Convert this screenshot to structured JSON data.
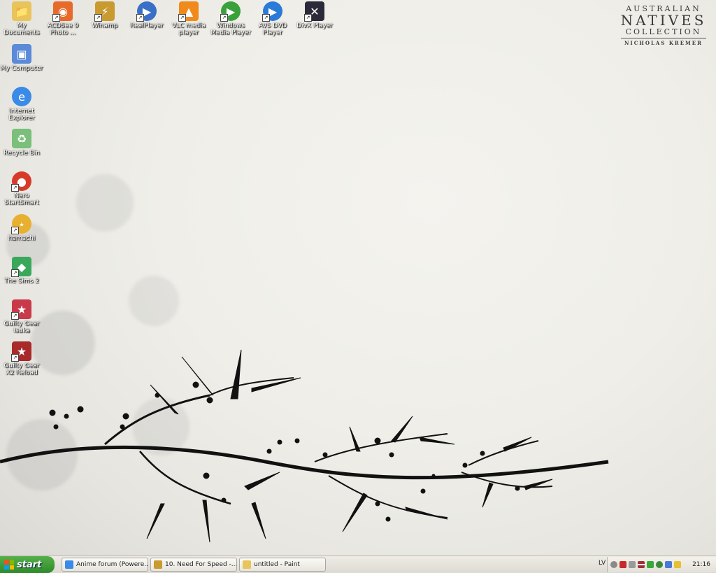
{
  "branding": {
    "line1": "AUSTRALIAN",
    "line2": "NATIVES",
    "line3": "COLLECTION",
    "line4": "NICHOLAS KREMER"
  },
  "desktop_icons": [
    {
      "label": "My Documents",
      "icon": "folder-icon",
      "color": "#e8c45a"
    },
    {
      "label": "ACDSee 9 Photo ...",
      "icon": "acdsee-icon",
      "color": "#e86a2a"
    },
    {
      "label": "Winamp",
      "icon": "winamp-icon",
      "color": "#c89a30"
    },
    {
      "label": "RealPlayer",
      "icon": "realplayer-icon",
      "color": "#3a6fc8"
    },
    {
      "label": "VLC media player",
      "icon": "vlc-cone-icon",
      "color": "#f08a1a"
    },
    {
      "label": "Windows Media Player",
      "icon": "wmp-icon",
      "color": "#3aa03a"
    },
    {
      "label": "AVS DVD Player",
      "icon": "avs-dvd-icon",
      "color": "#2a7ad8"
    },
    {
      "label": "DivX Player",
      "icon": "divx-icon",
      "color": "#2a2a3a"
    },
    {
      "label": "My Computer",
      "icon": "computer-icon",
      "color": "#5a8ad8"
    },
    {
      "label": "Internet Explorer",
      "icon": "ie-icon",
      "color": "#3a8ae8"
    },
    {
      "label": "Recycle Bin",
      "icon": "recycle-bin-icon",
      "color": "#7abf7a"
    },
    {
      "label": "Nero StartSmart",
      "icon": "nero-icon",
      "color": "#d83a2a"
    },
    {
      "label": "hamachi",
      "icon": "hamachi-icon",
      "color": "#e8b030"
    },
    {
      "label": "The Sims 2",
      "icon": "sims-icon",
      "color": "#3aa85a"
    },
    {
      "label": "Guilty Gear Isuka",
      "icon": "guilty-gear-icon",
      "color": "#c83a4a"
    },
    {
      "label": "Guilty Gear X2 Reload",
      "icon": "guilty-gear-x2-icon",
      "color": "#a82a2a"
    }
  ],
  "taskbar": {
    "start_label": "start",
    "tasks": [
      {
        "label": "Anime forum (Powere...",
        "icon": "ie-icon",
        "color": "#3a8ae8"
      },
      {
        "label": "10. Need For Speed -...",
        "icon": "winamp-icon",
        "color": "#c89a30"
      },
      {
        "label": "untitled - Paint",
        "icon": "paint-icon",
        "color": "#e8c45a"
      }
    ],
    "language": "LV",
    "tray_icons": [
      {
        "icon": "back-arrow-icon",
        "color": "#8a8a8a"
      },
      {
        "icon": "kaspersky-icon",
        "color": "#c82a2a"
      },
      {
        "icon": "speaker-icon",
        "color": "#9a9a9a"
      },
      {
        "icon": "flag-lv-icon",
        "color": "#9e3039"
      },
      {
        "icon": "msn-icon",
        "color": "#3aa83a"
      },
      {
        "icon": "sync-icon",
        "color": "#3a8a3a"
      },
      {
        "icon": "network-icon",
        "color": "#4a7ad8"
      },
      {
        "icon": "shield-icon",
        "color": "#e8c030"
      }
    ],
    "clock": "21:16"
  }
}
